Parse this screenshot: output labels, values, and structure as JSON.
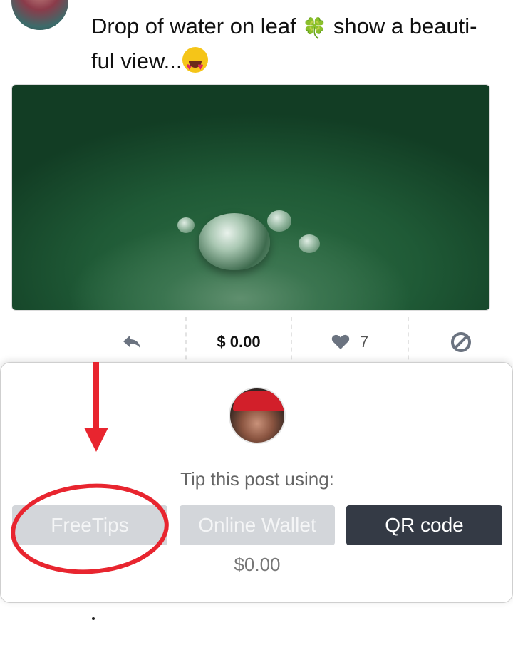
{
  "post": {
    "text_part1": "Drop of water on leaf ",
    "clover_emoji": "🍀",
    "text_part2": " show a beauti-ful view...",
    "emoji_name": "heart-eyes-emoji"
  },
  "actions": {
    "price": "$ 0.00",
    "like_count": "7",
    "icons": [
      "reply-icon",
      "heart-icon",
      "block-icon"
    ]
  },
  "tip_modal": {
    "title": "Tip this post using:",
    "buttons": {
      "freetips": "FreeTips",
      "online_wallet": "Online Wallet",
      "qr_code": "QR code"
    },
    "amount": "$0.00"
  },
  "colors": {
    "disabled_button": "#d3d6da",
    "primary_button": "#343a45",
    "annotation": "#e8252f"
  }
}
